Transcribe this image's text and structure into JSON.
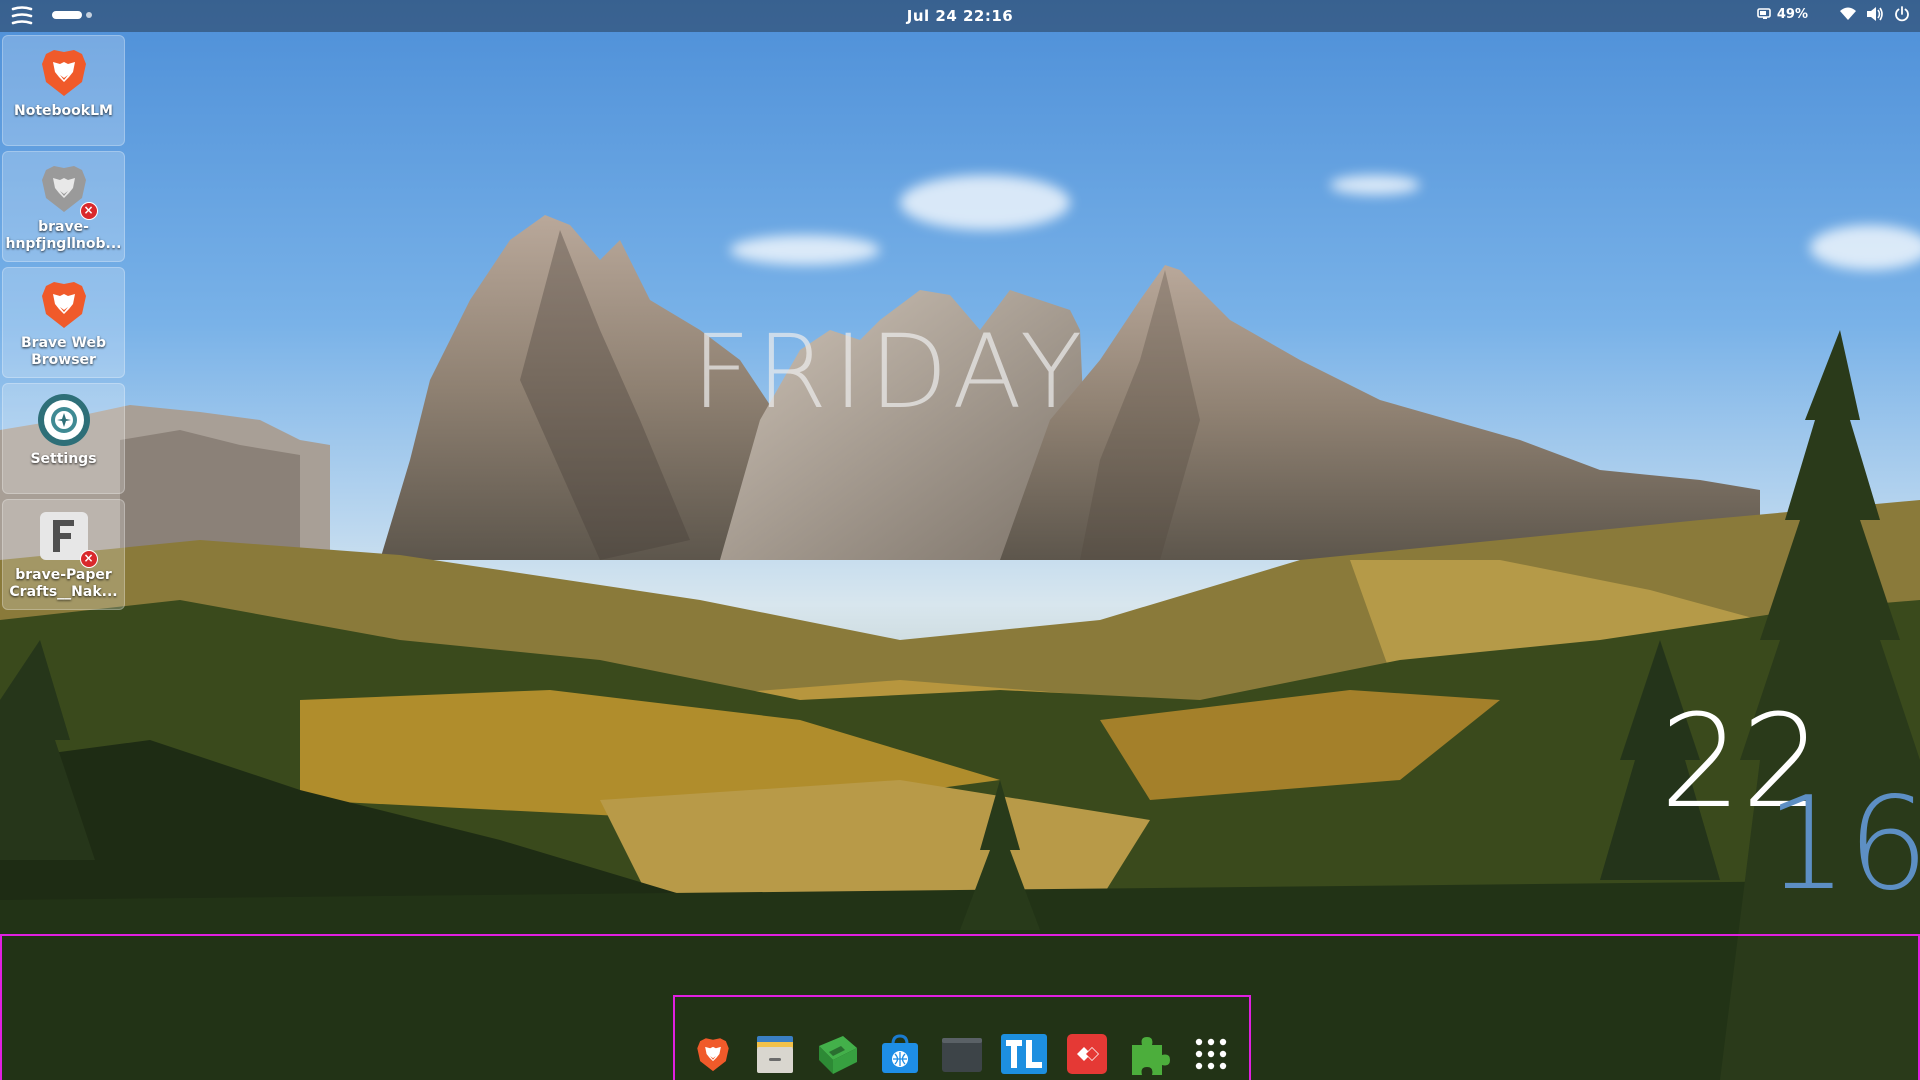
{
  "topbar": {
    "clock": "Jul 24  22:16",
    "battery_percent": "49%",
    "icons": [
      "app-menu-icon",
      "workspace-indicator",
      "battery-icon",
      "wifi-icon",
      "volume-icon",
      "power-icon"
    ]
  },
  "desktop": {
    "icons": [
      {
        "label": "NotebookLM",
        "icon": "brave-lion-icon",
        "broken": false
      },
      {
        "label": "brave-hnpfjngllnob...",
        "icon": "brave-lion-icon-gray",
        "broken": true
      },
      {
        "label": "Brave Web Browser",
        "icon": "brave-lion-icon",
        "broken": false
      },
      {
        "label": "Settings",
        "icon": "settings-gear-icon",
        "broken": false
      },
      {
        "label": "brave-Paper Crafts__Nak...",
        "icon": "paper-f-icon",
        "broken": true
      }
    ]
  },
  "overlay": {
    "day": "FRIDAY",
    "hour": "22",
    "minute": "16"
  },
  "dock": {
    "apps": [
      {
        "name": "Brave",
        "icon": "brave-lion-icon"
      },
      {
        "name": "Files",
        "icon": "files-icon"
      },
      {
        "name": "Package",
        "icon": "package-icon"
      },
      {
        "name": "Software Store",
        "icon": "store-bag-icon"
      },
      {
        "name": "Terminal",
        "icon": "terminal-icon"
      },
      {
        "name": "TL",
        "icon": "tl-icon"
      },
      {
        "name": "AnyDesk",
        "icon": "anydesk-icon"
      },
      {
        "name": "Extensions",
        "icon": "puzzle-icon"
      },
      {
        "name": "Show Apps",
        "icon": "apps-grid-icon"
      }
    ]
  },
  "colors": {
    "accent_magenta": "#e020e0",
    "minute_blue": "#5d8fc4",
    "brave_orange": "#f05a2a",
    "badge_red": "#d9292c"
  }
}
